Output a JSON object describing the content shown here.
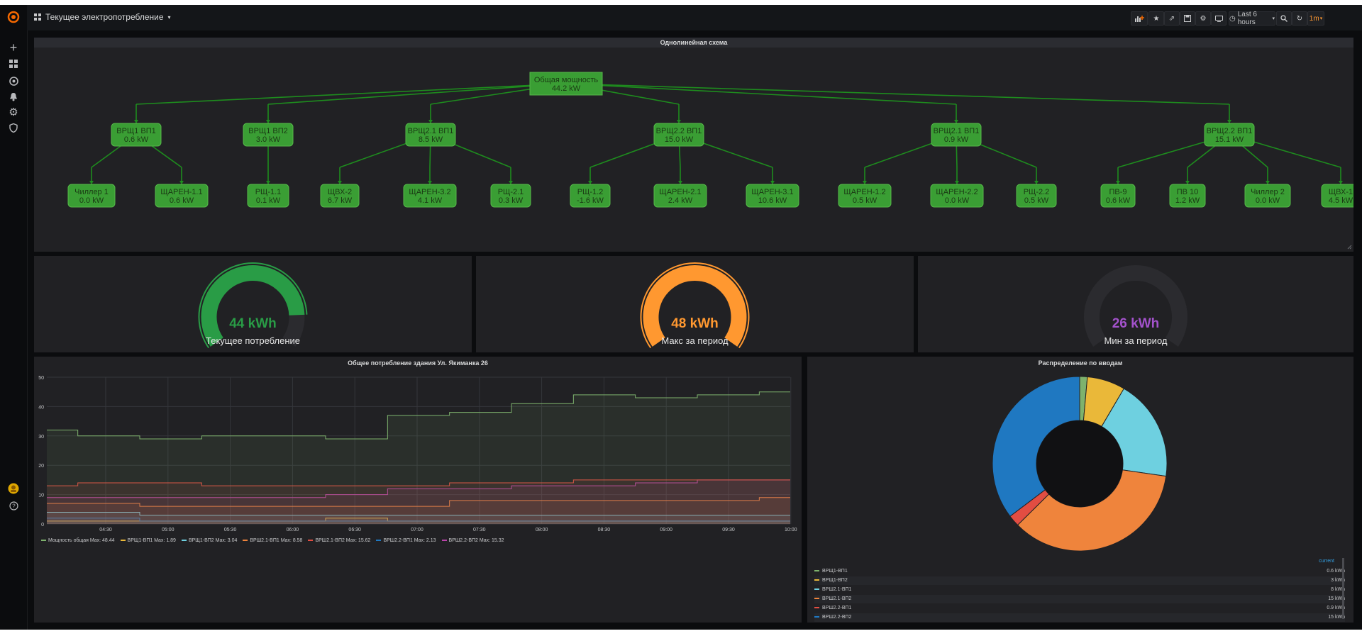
{
  "dashboard": {
    "title": "Текущее электропотребление"
  },
  "toolbar": {
    "time_range": "Last 6 hours",
    "refresh": "1m"
  },
  "schema": {
    "title": "Однолинейная схема",
    "root": {
      "name": "Общая мощность",
      "value": "44.2 kW"
    },
    "level1": [
      {
        "name": "ВРЩ1 ВП1",
        "value": "0.6 kW"
      },
      {
        "name": "ВРЩ1 ВП2",
        "value": "3.0 kW"
      },
      {
        "name": "ВРЩ2.1 ВП1",
        "value": "8.5 kW"
      },
      {
        "name": "ВРЩ2.2 ВП1",
        "value": "15.0 kW"
      },
      {
        "name": "ВРЩ2.1 ВП1",
        "value": "0.9 kW"
      },
      {
        "name": "ВРЩ2.2 ВП1",
        "value": "15.1 kW"
      }
    ],
    "level2": [
      {
        "name": "Чиллер 1",
        "value": "0.0 kW"
      },
      {
        "name": "ЩАРЕН-1.1",
        "value": "0.6 kW"
      },
      {
        "name": "РЩ-1.1",
        "value": "0.1 kW"
      },
      {
        "name": "ЩВХ-2",
        "value": "6.7 kW"
      },
      {
        "name": "ЩАРЕН-3.2",
        "value": "4.1 kW"
      },
      {
        "name": "РЩ-2.1",
        "value": "0.3 kW"
      },
      {
        "name": "РЩ-1.2",
        "value": "-1.6 kW"
      },
      {
        "name": "ЩАРЕН-2.1",
        "value": "2.4 kW"
      },
      {
        "name": "ЩАРЕН-3.1",
        "value": "10.6 kW"
      },
      {
        "name": "ЩАРЕН-1.2",
        "value": "0.5 kW"
      },
      {
        "name": "ЩАРЕН-2.2",
        "value": "0.0 kW"
      },
      {
        "name": "РЩ-2.2",
        "value": "0.5 kW"
      },
      {
        "name": "ПВ-9",
        "value": "0.6 kW"
      },
      {
        "name": "ПВ 10",
        "value": "1.2 kW"
      },
      {
        "name": "Чиллер 2",
        "value": "0.0 kW"
      },
      {
        "name": "ЩВХ-1",
        "value": "4.5 kW"
      }
    ]
  },
  "gauges": [
    {
      "value": "44 kWh",
      "label": "Текущее потребление",
      "color": "#299c46",
      "fraction": 0.85
    },
    {
      "value": "48 kWh",
      "label": "Макс за период",
      "color": "#ff9830",
      "fraction": 1.0
    },
    {
      "value": "26 kWh",
      "label": "Мин за период",
      "color": "#a352cc",
      "fraction": 0.0
    }
  ],
  "line_panel": {
    "title": "Общее потребление здания Ул. Якиманка 26",
    "legend": [
      {
        "label": "Мощность общая  Max: 48.44",
        "color": "#7eb26d"
      },
      {
        "label": "ВРЩ1-ВП1  Max: 1.89",
        "color": "#eab839"
      },
      {
        "label": "ВРЩ1-ВП2  Max: 3.04",
        "color": "#6ed0e0"
      },
      {
        "label": "ВРШ2.1-ВП1  Max: 8.58",
        "color": "#ef843c"
      },
      {
        "label": "ВРШ2.1-ВП2  Max: 15.62",
        "color": "#e24d42"
      },
      {
        "label": "ВРШ2.2-ВП1  Max: 2.13",
        "color": "#1f78c1"
      },
      {
        "label": "ВРШ2.2-ВП2  Max: 15.32",
        "color": "#ba43a9"
      }
    ]
  },
  "pie_panel": {
    "title": "Распределение по вводам",
    "legend_header": "current",
    "legend": [
      {
        "label": "ВРЩ1-ВП1",
        "value": "0.6 kWh",
        "color": "#7eb26d"
      },
      {
        "label": "ВРЩ1-ВП2",
        "value": "3 kWh",
        "color": "#eab839"
      },
      {
        "label": "ВРШ2.1-ВП1",
        "value": "8 kWh",
        "color": "#6ed0e0"
      },
      {
        "label": "ВРШ2.1-ВП2",
        "value": "15 kWh",
        "color": "#ef843c"
      },
      {
        "label": "ВРШ2.2-ВП1",
        "value": "0.9 kWh",
        "color": "#e24d42"
      },
      {
        "label": "ВРШ2.2-ВП2",
        "value": "15 kWh",
        "color": "#1f78c1"
      }
    ]
  },
  "chart_data": [
    {
      "type": "line",
      "title": "Общее потребление здания Ул. Якиманка 26",
      "x": [
        "04:30",
        "05:00",
        "05:30",
        "06:00",
        "06:30",
        "07:00",
        "07:30",
        "08:00",
        "08:30",
        "09:00",
        "09:30",
        "10:00"
      ],
      "ylim": [
        0,
        50
      ],
      "yticks": [
        0,
        10,
        20,
        30,
        40,
        50
      ],
      "series": [
        {
          "name": "Мощность общая",
          "values": [
            32,
            30,
            29,
            30,
            30,
            29,
            37,
            38,
            41,
            44,
            43,
            44,
            45
          ],
          "color": "#7eb26d"
        },
        {
          "name": "ВРШ2.1-ВП2",
          "values": [
            13,
            14,
            14,
            13,
            13,
            13,
            13,
            14,
            14,
            15,
            15,
            15,
            15
          ],
          "color": "#e24d42"
        },
        {
          "name": "ВРШ2.2-ВП2",
          "values": [
            9,
            9,
            9,
            9,
            9,
            10,
            12,
            12,
            13,
            13,
            14,
            15,
            15
          ],
          "color": "#ba43a9"
        },
        {
          "name": "ВРШ2.1-ВП1",
          "values": [
            7,
            7,
            6,
            6,
            6,
            6,
            6,
            8,
            8,
            8,
            8,
            8,
            9
          ],
          "color": "#ef843c"
        },
        {
          "name": "ВРЩ1-ВП2",
          "values": [
            4,
            4,
            3,
            3,
            3,
            3,
            3,
            3,
            3,
            3,
            3,
            3,
            3
          ],
          "color": "#6ed0e0"
        },
        {
          "name": "ВРШ2.2-ВП1",
          "values": [
            2,
            2,
            1,
            1,
            1,
            1,
            1,
            1,
            1,
            1,
            1,
            1,
            1
          ],
          "color": "#1f78c1"
        },
        {
          "name": "ВРЩ1-ВП1",
          "values": [
            1,
            1,
            1,
            1,
            1,
            2,
            1,
            1,
            1,
            1,
            1,
            1,
            1
          ],
          "color": "#eab839"
        }
      ]
    },
    {
      "type": "pie",
      "title": "Распределение по вводам",
      "categories": [
        "ВРЩ1-ВП1",
        "ВРЩ1-ВП2",
        "ВРШ2.1-ВП1",
        "ВРШ2.1-ВП2",
        "ВРШ2.2-ВП1",
        "ВРШ2.2-ВП2"
      ],
      "values": [
        0.6,
        3,
        8,
        15,
        0.9,
        15
      ],
      "colors": [
        "#7eb26d",
        "#eab839",
        "#6ed0e0",
        "#ef843c",
        "#e24d42",
        "#1f78c1"
      ]
    }
  ]
}
